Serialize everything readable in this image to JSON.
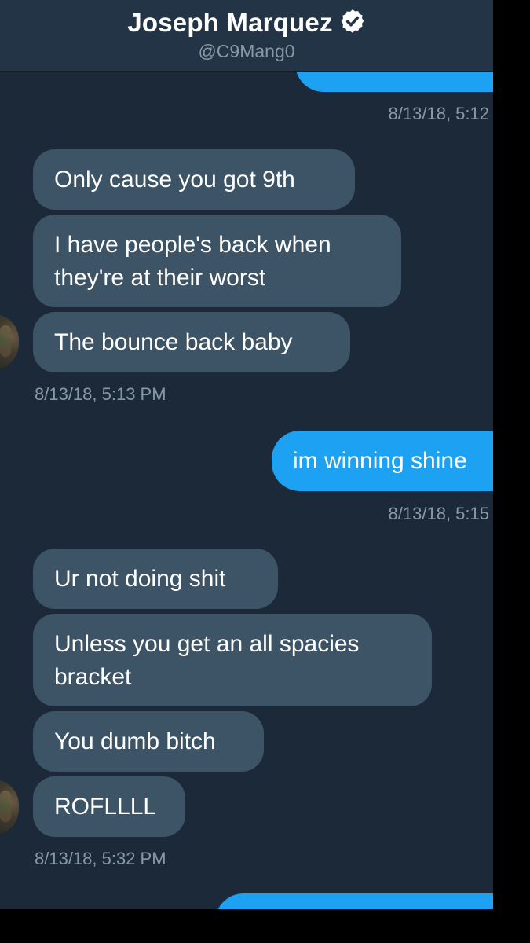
{
  "header": {
    "name": "Joseph Marquez",
    "handle": "@C9Mang0"
  },
  "messages": [
    {
      "id": "m1",
      "text": "Only cause you got 9th"
    },
    {
      "id": "m2",
      "text": "I have people's back when they're at their worst"
    },
    {
      "id": "m3",
      "text": "The bounce back baby"
    },
    {
      "id": "m4",
      "text": "im winning shine"
    },
    {
      "id": "m5",
      "text": "Ur not doing shit"
    },
    {
      "id": "m6",
      "text": "Unless you get an all spacies bracket"
    },
    {
      "id": "m7",
      "text": "You dumb bitch"
    },
    {
      "id": "m8",
      "text": "ROFLLLL"
    }
  ],
  "timestamps": {
    "t1": "8/13/18, 5:12",
    "t2": "8/13/18, 5:13 PM",
    "t3": "8/13/18, 5:15",
    "t4": "8/13/18, 5:32 PM"
  }
}
